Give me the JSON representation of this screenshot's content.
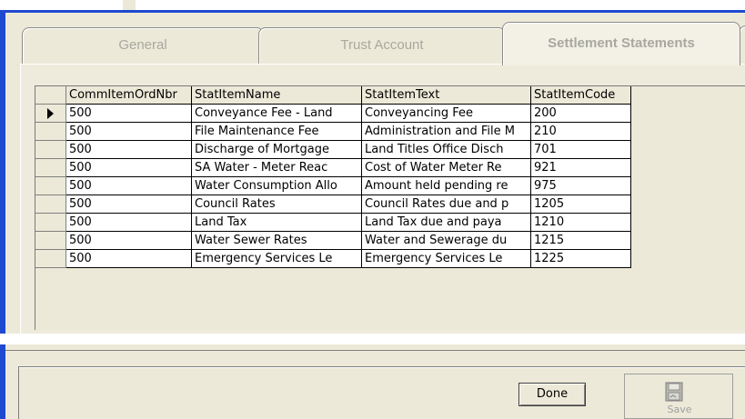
{
  "tabs": [
    {
      "label": "General"
    },
    {
      "label": "Trust Account"
    },
    {
      "label": "Settlement Statements"
    }
  ],
  "grid": {
    "columns": [
      "CommItemOrdNbr",
      "StatItemName",
      "StatItemText",
      "StatItemCode"
    ],
    "rows": [
      [
        "500",
        "Conveyance Fee - Land",
        "Conveyancing Fee",
        "200"
      ],
      [
        "500",
        "File Maintenance Fee",
        "Administration and File M",
        "210"
      ],
      [
        "500",
        "Discharge of Mortgage",
        "Land Titles Office Disch",
        "701"
      ],
      [
        "500",
        "SA Water -  Meter Reac",
        "Cost of Water Meter Re",
        "921"
      ],
      [
        "500",
        "Water Consumption Allo",
        "Amount held pending re",
        "975"
      ],
      [
        "500",
        "Council Rates",
        "Council Rates due and p",
        "1205"
      ],
      [
        "500",
        "Land Tax",
        "Land Tax due and paya",
        "1210"
      ],
      [
        "500",
        "Water Sewer Rates",
        "Water and Sewerage du",
        "1215"
      ],
      [
        "500",
        "Emergency Services Le",
        "Emergency Services Le",
        "1225"
      ]
    ],
    "selected_row_index": 0
  },
  "buttons": {
    "done": "Done",
    "save": "Save"
  },
  "icons": {
    "row_selector": "triangle-right-icon",
    "save": "floppy-disk-icon"
  },
  "colors": {
    "window_border": "#1f49d0",
    "face": "#ece9d8",
    "disabled_text": "#a8a8a0"
  }
}
